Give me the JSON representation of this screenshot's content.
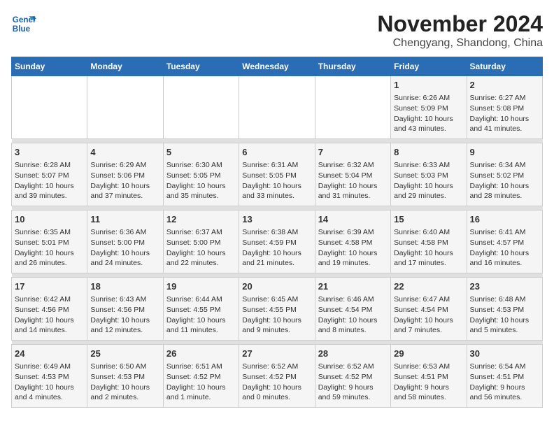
{
  "logo": {
    "text_line1": "General",
    "text_line2": "Blue"
  },
  "title": "November 2024",
  "subtitle": "Chengyang, Shandong, China",
  "weekdays": [
    "Sunday",
    "Monday",
    "Tuesday",
    "Wednesday",
    "Thursday",
    "Friday",
    "Saturday"
  ],
  "weeks": [
    [
      {
        "day": "",
        "info": ""
      },
      {
        "day": "",
        "info": ""
      },
      {
        "day": "",
        "info": ""
      },
      {
        "day": "",
        "info": ""
      },
      {
        "day": "",
        "info": ""
      },
      {
        "day": "1",
        "info": "Sunrise: 6:26 AM\nSunset: 5:09 PM\nDaylight: 10 hours\nand 43 minutes."
      },
      {
        "day": "2",
        "info": "Sunrise: 6:27 AM\nSunset: 5:08 PM\nDaylight: 10 hours\nand 41 minutes."
      }
    ],
    [
      {
        "day": "3",
        "info": "Sunrise: 6:28 AM\nSunset: 5:07 PM\nDaylight: 10 hours\nand 39 minutes."
      },
      {
        "day": "4",
        "info": "Sunrise: 6:29 AM\nSunset: 5:06 PM\nDaylight: 10 hours\nand 37 minutes."
      },
      {
        "day": "5",
        "info": "Sunrise: 6:30 AM\nSunset: 5:05 PM\nDaylight: 10 hours\nand 35 minutes."
      },
      {
        "day": "6",
        "info": "Sunrise: 6:31 AM\nSunset: 5:05 PM\nDaylight: 10 hours\nand 33 minutes."
      },
      {
        "day": "7",
        "info": "Sunrise: 6:32 AM\nSunset: 5:04 PM\nDaylight: 10 hours\nand 31 minutes."
      },
      {
        "day": "8",
        "info": "Sunrise: 6:33 AM\nSunset: 5:03 PM\nDaylight: 10 hours\nand 29 minutes."
      },
      {
        "day": "9",
        "info": "Sunrise: 6:34 AM\nSunset: 5:02 PM\nDaylight: 10 hours\nand 28 minutes."
      }
    ],
    [
      {
        "day": "10",
        "info": "Sunrise: 6:35 AM\nSunset: 5:01 PM\nDaylight: 10 hours\nand 26 minutes."
      },
      {
        "day": "11",
        "info": "Sunrise: 6:36 AM\nSunset: 5:00 PM\nDaylight: 10 hours\nand 24 minutes."
      },
      {
        "day": "12",
        "info": "Sunrise: 6:37 AM\nSunset: 5:00 PM\nDaylight: 10 hours\nand 22 minutes."
      },
      {
        "day": "13",
        "info": "Sunrise: 6:38 AM\nSunset: 4:59 PM\nDaylight: 10 hours\nand 21 minutes."
      },
      {
        "day": "14",
        "info": "Sunrise: 6:39 AM\nSunset: 4:58 PM\nDaylight: 10 hours\nand 19 minutes."
      },
      {
        "day": "15",
        "info": "Sunrise: 6:40 AM\nSunset: 4:58 PM\nDaylight: 10 hours\nand 17 minutes."
      },
      {
        "day": "16",
        "info": "Sunrise: 6:41 AM\nSunset: 4:57 PM\nDaylight: 10 hours\nand 16 minutes."
      }
    ],
    [
      {
        "day": "17",
        "info": "Sunrise: 6:42 AM\nSunset: 4:56 PM\nDaylight: 10 hours\nand 14 minutes."
      },
      {
        "day": "18",
        "info": "Sunrise: 6:43 AM\nSunset: 4:56 PM\nDaylight: 10 hours\nand 12 minutes."
      },
      {
        "day": "19",
        "info": "Sunrise: 6:44 AM\nSunset: 4:55 PM\nDaylight: 10 hours\nand 11 minutes."
      },
      {
        "day": "20",
        "info": "Sunrise: 6:45 AM\nSunset: 4:55 PM\nDaylight: 10 hours\nand 9 minutes."
      },
      {
        "day": "21",
        "info": "Sunrise: 6:46 AM\nSunset: 4:54 PM\nDaylight: 10 hours\nand 8 minutes."
      },
      {
        "day": "22",
        "info": "Sunrise: 6:47 AM\nSunset: 4:54 PM\nDaylight: 10 hours\nand 7 minutes."
      },
      {
        "day": "23",
        "info": "Sunrise: 6:48 AM\nSunset: 4:53 PM\nDaylight: 10 hours\nand 5 minutes."
      }
    ],
    [
      {
        "day": "24",
        "info": "Sunrise: 6:49 AM\nSunset: 4:53 PM\nDaylight: 10 hours\nand 4 minutes."
      },
      {
        "day": "25",
        "info": "Sunrise: 6:50 AM\nSunset: 4:53 PM\nDaylight: 10 hours\nand 2 minutes."
      },
      {
        "day": "26",
        "info": "Sunrise: 6:51 AM\nSunset: 4:52 PM\nDaylight: 10 hours\nand 1 minute."
      },
      {
        "day": "27",
        "info": "Sunrise: 6:52 AM\nSunset: 4:52 PM\nDaylight: 10 hours\nand 0 minutes."
      },
      {
        "day": "28",
        "info": "Sunrise: 6:52 AM\nSunset: 4:52 PM\nDaylight: 9 hours\nand 59 minutes."
      },
      {
        "day": "29",
        "info": "Sunrise: 6:53 AM\nSunset: 4:51 PM\nDaylight: 9 hours\nand 58 minutes."
      },
      {
        "day": "30",
        "info": "Sunrise: 6:54 AM\nSunset: 4:51 PM\nDaylight: 9 hours\nand 56 minutes."
      }
    ]
  ]
}
